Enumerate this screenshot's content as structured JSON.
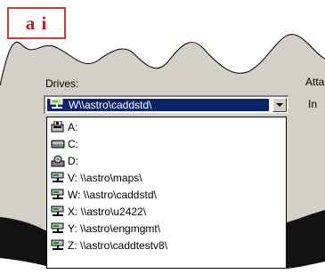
{
  "callout": {
    "label": "a i"
  },
  "form": {
    "drives_label": "Drives:",
    "side_label_1": "Atta",
    "side_label_2": "In"
  },
  "combo": {
    "selected": "W\\\\astro\\caddstd\\",
    "icon": "network-drive-icon"
  },
  "drives": [
    {
      "label": "A:",
      "icon": "floppy-drive-icon"
    },
    {
      "label": "C:",
      "icon": "hard-drive-icon"
    },
    {
      "label": "D:",
      "icon": "cd-drive-icon"
    },
    {
      "label": "V:  \\\\astro\\maps\\",
      "icon": "network-drive-icon"
    },
    {
      "label": "W:  \\\\astro\\caddstd\\",
      "icon": "network-drive-icon"
    },
    {
      "label": "X:  \\\\astro\\u2422\\",
      "icon": "network-drive-icon"
    },
    {
      "label": "Y:  \\\\astro\\engmgmt\\",
      "icon": "network-drive-icon"
    },
    {
      "label": "Z:  \\\\astro\\caddtestv8\\",
      "icon": "network-drive-icon"
    }
  ],
  "colors": {
    "selection": "#0a246a",
    "callout_border": "#d83a2a",
    "callout_text": "#cc1a1a"
  }
}
